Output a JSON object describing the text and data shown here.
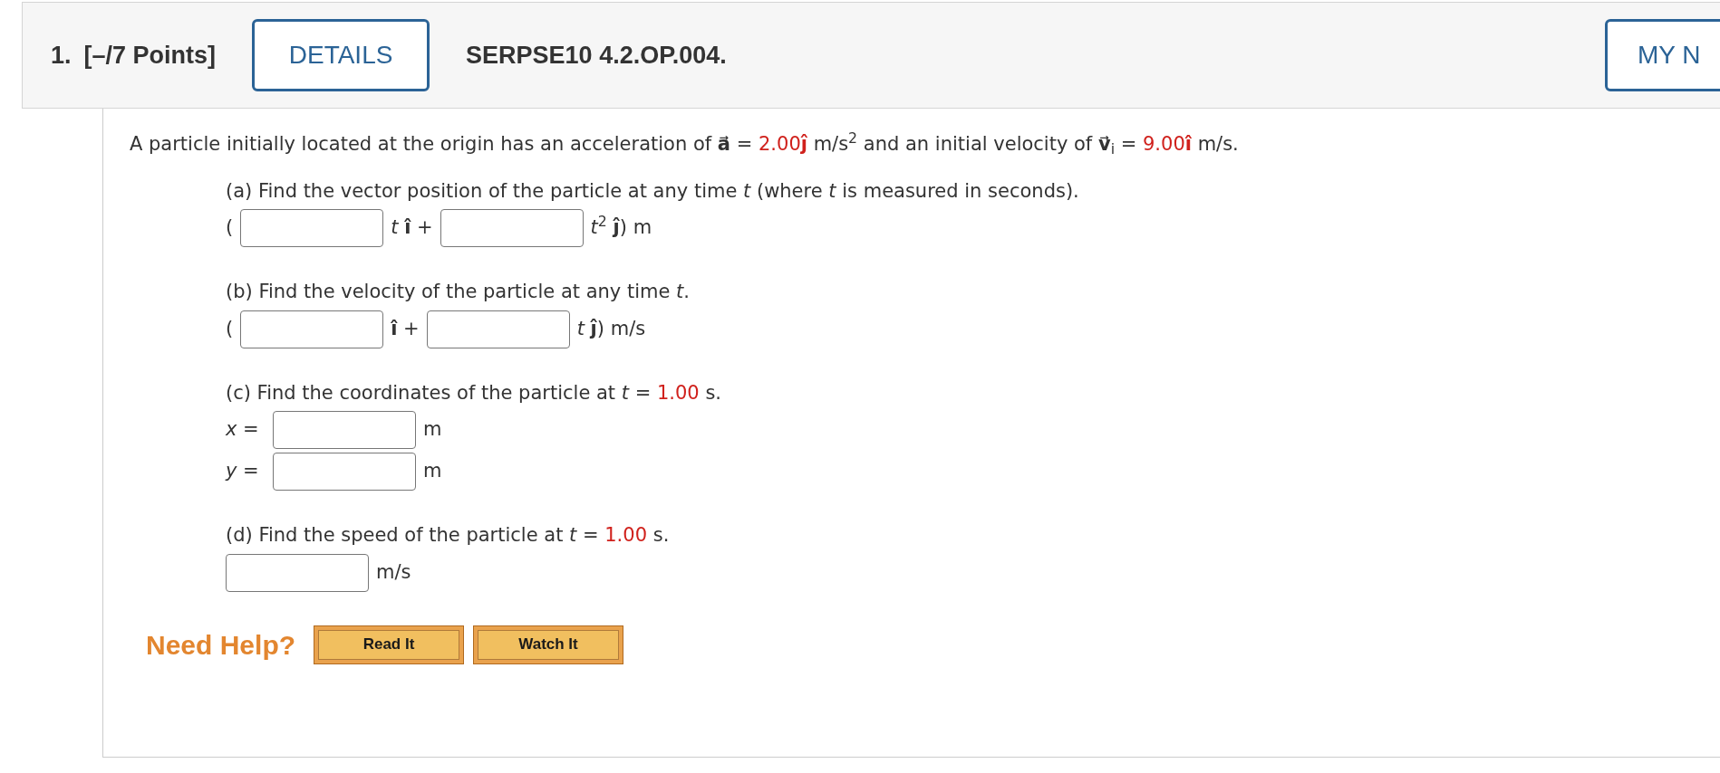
{
  "header": {
    "number": "1.",
    "points": "[–/7 Points]",
    "details_button": "DETAILS",
    "question_id": "SERPSE10 4.2.OP.004.",
    "notes_button": "MY N"
  },
  "statement": [
    {
      "kind": "text",
      "text": "A particle initially located at the origin has an acceleration of **a⃗** = "
    },
    {
      "kind": "given",
      "text": "2.00**ĵ**"
    },
    {
      "kind": "text",
      "text": " m/s$^{2}$ and an initial velocity of **v⃗**$_{i}$ = "
    },
    {
      "kind": "given",
      "text": "9.00**î**"
    },
    {
      "kind": "text",
      "text": " m/s."
    }
  ],
  "parts": [
    {
      "question": [
        {
          "kind": "text",
          "text": "(a) Find the vector position of the particle at any time *t* (where *t* is measured in seconds)."
        }
      ],
      "rows": [
        [
          {
            "kind": "text",
            "text": "("
          },
          {
            "kind": "input"
          },
          {
            "kind": "text",
            "text": "*t* **î** +"
          },
          {
            "kind": "input"
          },
          {
            "kind": "text",
            "text": "*t*$^{2}$ **ĵ**) m"
          }
        ]
      ]
    },
    {
      "question": [
        {
          "kind": "text",
          "text": "(b) Find the velocity of the particle at any time *t*."
        }
      ],
      "rows": [
        [
          {
            "kind": "text",
            "text": "("
          },
          {
            "kind": "input"
          },
          {
            "kind": "text",
            "text": "**î** +"
          },
          {
            "kind": "input"
          },
          {
            "kind": "text",
            "text": "*t* **ĵ**) m/s"
          }
        ]
      ]
    },
    {
      "question": [
        {
          "kind": "text",
          "text": "(c) Find the coordinates of the particle at *t* = "
        },
        {
          "kind": "given",
          "text": "1.00"
        },
        {
          "kind": "text",
          "text": " s."
        }
      ],
      "rows": [
        [
          {
            "kind": "label",
            "text": "*x* ="
          },
          {
            "kind": "input"
          },
          {
            "kind": "text",
            "text": "m"
          }
        ],
        [
          {
            "kind": "label",
            "text": "*y* ="
          },
          {
            "kind": "input"
          },
          {
            "kind": "text",
            "text": "m"
          }
        ]
      ]
    },
    {
      "question": [
        {
          "kind": "text",
          "text": "(d) Find the speed of the particle at *t* = "
        },
        {
          "kind": "given",
          "text": "1.00"
        },
        {
          "kind": "text",
          "text": " s."
        }
      ],
      "rows": [
        [
          {
            "kind": "input"
          },
          {
            "kind": "text",
            "text": "m/s"
          }
        ]
      ]
    }
  ],
  "help": {
    "label": "Need Help?",
    "buttons": [
      "Read It",
      "Watch It"
    ]
  }
}
